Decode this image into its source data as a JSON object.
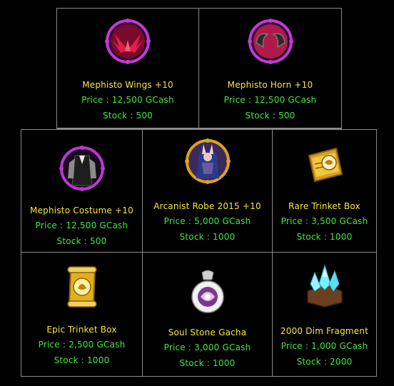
{
  "shop": {
    "row1": [
      {
        "name": "Mephisto Wings +10",
        "price": "Price : 12,500 GCash",
        "stock": "Stock : 500",
        "icon": "mephisto-wings-icon"
      },
      {
        "name": "Mephisto Horn +10",
        "price": "Price : 12,500 GCash",
        "stock": "Stock : 500",
        "icon": "mephisto-horn-icon"
      }
    ],
    "row2": [
      {
        "name": "Mephisto Costume +10",
        "price": "Price : 12,500 GCash",
        "stock": "Stock : 500",
        "icon": "mephisto-costume-icon"
      },
      {
        "name": "Arcanist Robe 2015 +10",
        "price": "Price : 5,000 GCash",
        "stock": "Stock : 1000",
        "icon": "arcanist-robe-icon"
      },
      {
        "name": "Rare Trinket Box",
        "price": "Price : 3,500 GCash",
        "stock": "Stock : 1000",
        "icon": "rare-trinket-box-icon"
      }
    ],
    "row3": [
      {
        "name": "Epic Trinket Box",
        "price": "Price : 2,500 GCash",
        "stock": "Stock : 1000",
        "icon": "epic-trinket-box-icon"
      },
      {
        "name": "Soul Stone Gacha",
        "price": "Price : 3,000 GCash",
        "stock": "Stock : 1000",
        "icon": "soul-stone-gacha-icon"
      },
      {
        "name": "2000 Dim Fragment",
        "price": "Price : 1,000 GCash",
        "stock": "Stock : 2000",
        "icon": "dim-fragment-icon"
      }
    ]
  },
  "colors": {
    "name": "#f5e93a",
    "price": "#3fe83f",
    "border": "#8a8a8a",
    "background": "#000000"
  }
}
